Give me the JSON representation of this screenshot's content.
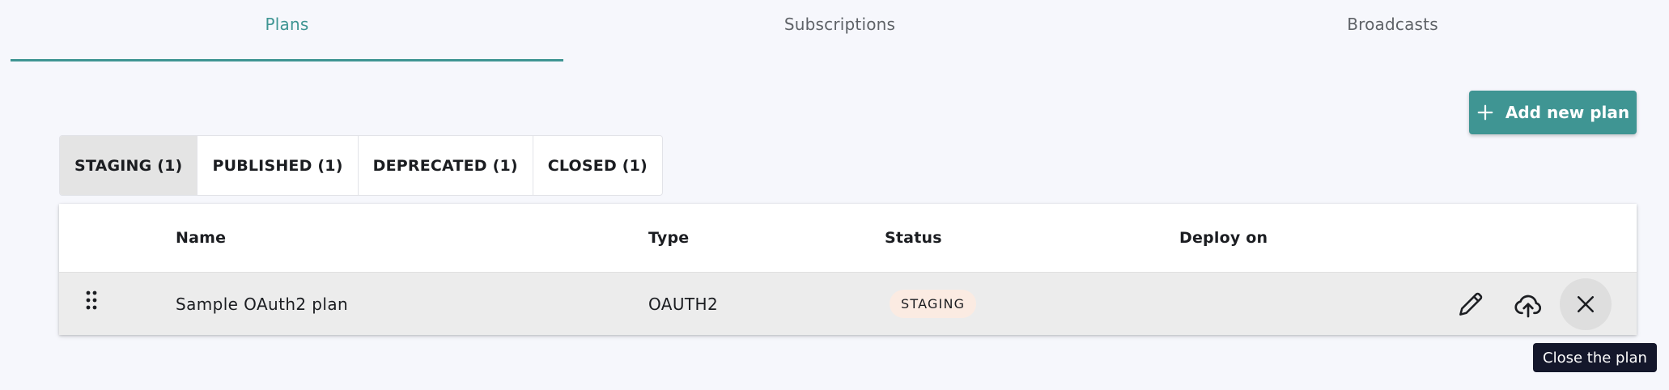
{
  "top_tabs": [
    {
      "label": "Plans",
      "active": true
    },
    {
      "label": "Subscriptions",
      "active": false
    },
    {
      "label": "Broadcasts",
      "active": false
    }
  ],
  "add_button": {
    "label": "Add new plan",
    "icon": "plus-icon"
  },
  "status_filters": [
    {
      "label": "STAGING (1)",
      "active": true
    },
    {
      "label": "PUBLISHED (1)",
      "active": false
    },
    {
      "label": "DEPRECATED (1)",
      "active": false
    },
    {
      "label": "CLOSED (1)",
      "active": false
    }
  ],
  "table": {
    "headers": {
      "name": "Name",
      "type": "Type",
      "status": "Status",
      "deploy_on": "Deploy on"
    },
    "rows": [
      {
        "name": "Sample OAuth2 plan",
        "type": "OAUTH2",
        "status": "STAGING",
        "deploy_on": "",
        "actions": [
          "edit-icon",
          "publish-icon",
          "close-icon"
        ]
      }
    ]
  },
  "tooltip": {
    "text": "Close the plan"
  },
  "colors": {
    "accent": "#3f9593",
    "background": "#f6f7fc",
    "staging_badge": "#fbebe2",
    "tooltip_bg": "#14172b"
  }
}
